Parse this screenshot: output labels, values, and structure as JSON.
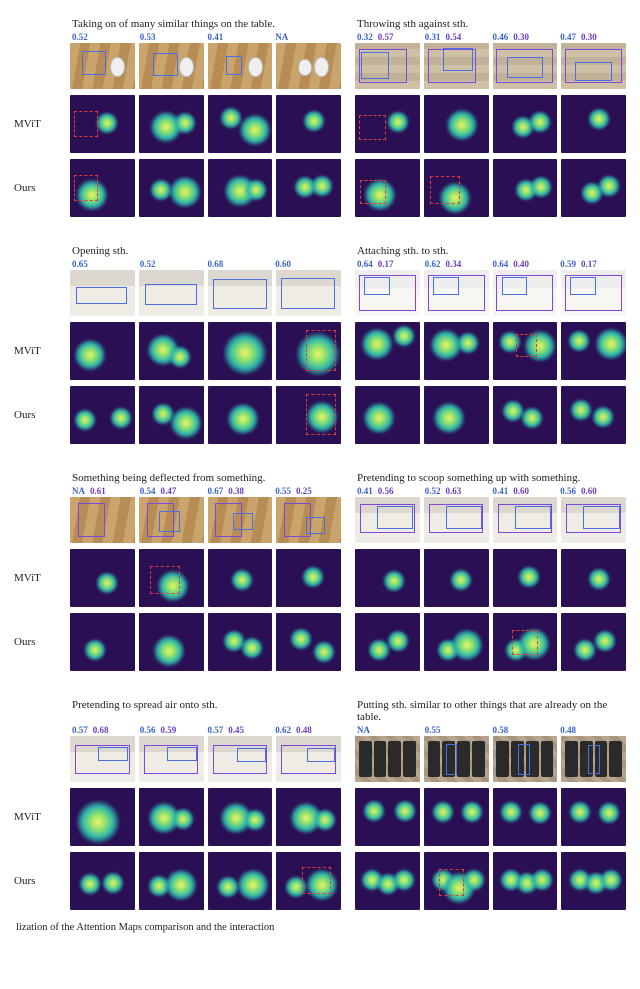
{
  "labels": {
    "mvit": "MViT",
    "ours": "Ours"
  },
  "caption_fragment": "lization of the Attention Maps comparison and the interaction",
  "blocks": [
    {
      "left": {
        "title": "Taking on of many similar things on the table.",
        "frames": [
          {
            "scores": [
              "0.52",
              "",
              ""
            ]
          },
          {
            "scores": [
              "0.53",
              "",
              ""
            ]
          },
          {
            "scores": [
              "0.41",
              "",
              ""
            ]
          },
          {
            "scores": [
              "NA",
              "",
              ""
            ]
          }
        ]
      },
      "right": {
        "title": "Throwing sth against sth.",
        "frames": [
          {
            "scores": [
              "0.32",
              "0.57",
              ""
            ]
          },
          {
            "scores": [
              "0.31",
              "0.54",
              ""
            ]
          },
          {
            "scores": [
              "0.46",
              "0.30",
              ""
            ]
          },
          {
            "scores": [
              "0.47",
              "0.30",
              ""
            ]
          }
        ]
      }
    },
    {
      "left": {
        "title": "Opening sth.",
        "frames": [
          {
            "scores": [
              "0.65",
              "",
              ""
            ]
          },
          {
            "scores": [
              "0.52",
              "",
              ""
            ]
          },
          {
            "scores": [
              "0.68",
              "",
              ""
            ]
          },
          {
            "scores": [
              "0.60",
              "",
              ""
            ]
          }
        ]
      },
      "right": {
        "title": "Attaching sth. to sth.",
        "frames": [
          {
            "scores": [
              "0.64",
              "0.17",
              ""
            ]
          },
          {
            "scores": [
              "0.62",
              "0.34",
              ""
            ]
          },
          {
            "scores": [
              "0.64",
              "0.40",
              ""
            ]
          },
          {
            "scores": [
              "0.59",
              "0.17",
              ""
            ]
          }
        ]
      }
    },
    {
      "left": {
        "title": "Something being deflected from something.",
        "frames": [
          {
            "scores": [
              "NA",
              "0.61",
              ""
            ]
          },
          {
            "scores": [
              "0.54",
              "0.47",
              ""
            ]
          },
          {
            "scores": [
              "0.67",
              "0.38",
              ""
            ]
          },
          {
            "scores": [
              "0.55",
              "0.25",
              ""
            ]
          }
        ]
      },
      "right": {
        "title": "Pretending to scoop something up with something.",
        "frames": [
          {
            "scores": [
              "0.41",
              "0.56",
              ""
            ]
          },
          {
            "scores": [
              "0.52",
              "0.63",
              ""
            ]
          },
          {
            "scores": [
              "0.41",
              "0.60",
              ""
            ]
          },
          {
            "scores": [
              "0.56",
              "0.60",
              ""
            ]
          }
        ]
      }
    },
    {
      "left": {
        "title": "Pretending to spread air onto sth.",
        "frames": [
          {
            "scores": [
              "0.57",
              "0.68",
              ""
            ]
          },
          {
            "scores": [
              "0.56",
              "0.59",
              ""
            ]
          },
          {
            "scores": [
              "0.57",
              "0.45",
              ""
            ]
          },
          {
            "scores": [
              "0.62",
              "0.48",
              ""
            ]
          }
        ]
      },
      "right": {
        "title": "Putting sth. similar to other things that are already on the table.",
        "frames": [
          {
            "scores": [
              "NA",
              "",
              ""
            ]
          },
          {
            "scores": [
              "0.55",
              "",
              ""
            ]
          },
          {
            "scores": [
              "0.58",
              "",
              ""
            ]
          },
          {
            "scores": [
              "0.48",
              "",
              ""
            ]
          }
        ]
      }
    }
  ]
}
